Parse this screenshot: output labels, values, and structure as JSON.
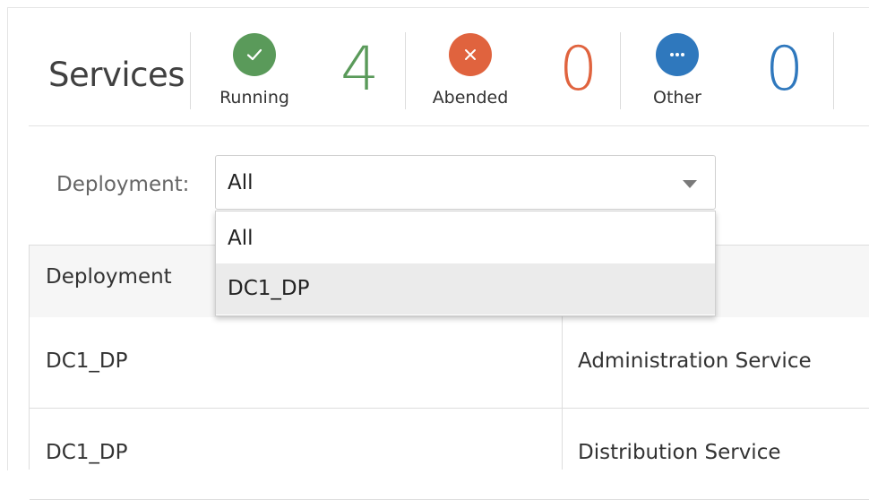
{
  "header": {
    "title": "Services",
    "stats": [
      {
        "label": "Running",
        "count": "4",
        "icon": "check-icon",
        "color": "#5a9a5a"
      },
      {
        "label": "Abended",
        "count": "0",
        "icon": "x-icon",
        "color": "#e0633e"
      },
      {
        "label": "Other",
        "count": "0",
        "icon": "ellipsis-icon",
        "color": "#2f78bd"
      }
    ]
  },
  "filter": {
    "label": "Deployment:",
    "selected": "All",
    "options": [
      "All",
      "DC1_DP"
    ]
  },
  "table": {
    "columns": [
      "Deployment",
      ""
    ],
    "rows": [
      [
        "DC1_DP",
        "Administration Service"
      ],
      [
        "DC1_DP",
        "Distribution Service"
      ]
    ]
  }
}
